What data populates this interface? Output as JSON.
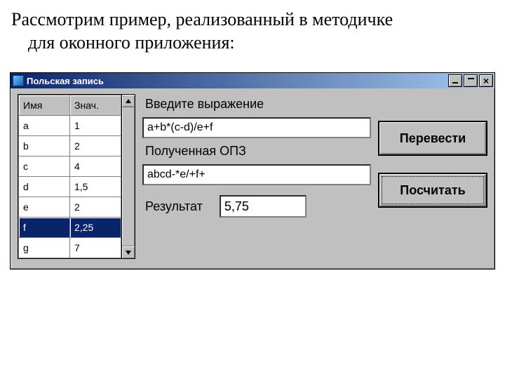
{
  "doc": {
    "line1": "Рассмотрим пример, реализованный в методичке",
    "line2": "для оконного приложения:"
  },
  "window": {
    "title": "Польская запись"
  },
  "grid": {
    "header_name": "Имя",
    "header_value": "Знач.",
    "rows": [
      {
        "name": "a",
        "value": "1"
      },
      {
        "name": "b",
        "value": "2"
      },
      {
        "name": "c",
        "value": "4"
      },
      {
        "name": "d",
        "value": "1,5"
      },
      {
        "name": "e",
        "value": "2"
      },
      {
        "name": "f",
        "value": "2,25"
      },
      {
        "name": "g",
        "value": "7"
      }
    ],
    "selected_index": 5
  },
  "labels": {
    "enter_expr": "Введите выражение",
    "got_rpn": "Полученная ОПЗ",
    "result": "Результат"
  },
  "fields": {
    "expression": "a+b*(c-d)/e+f",
    "rpn": "abcd-*e/+f+",
    "result": "5,75"
  },
  "buttons": {
    "translate": "Перевести",
    "calculate": "Посчитать"
  }
}
